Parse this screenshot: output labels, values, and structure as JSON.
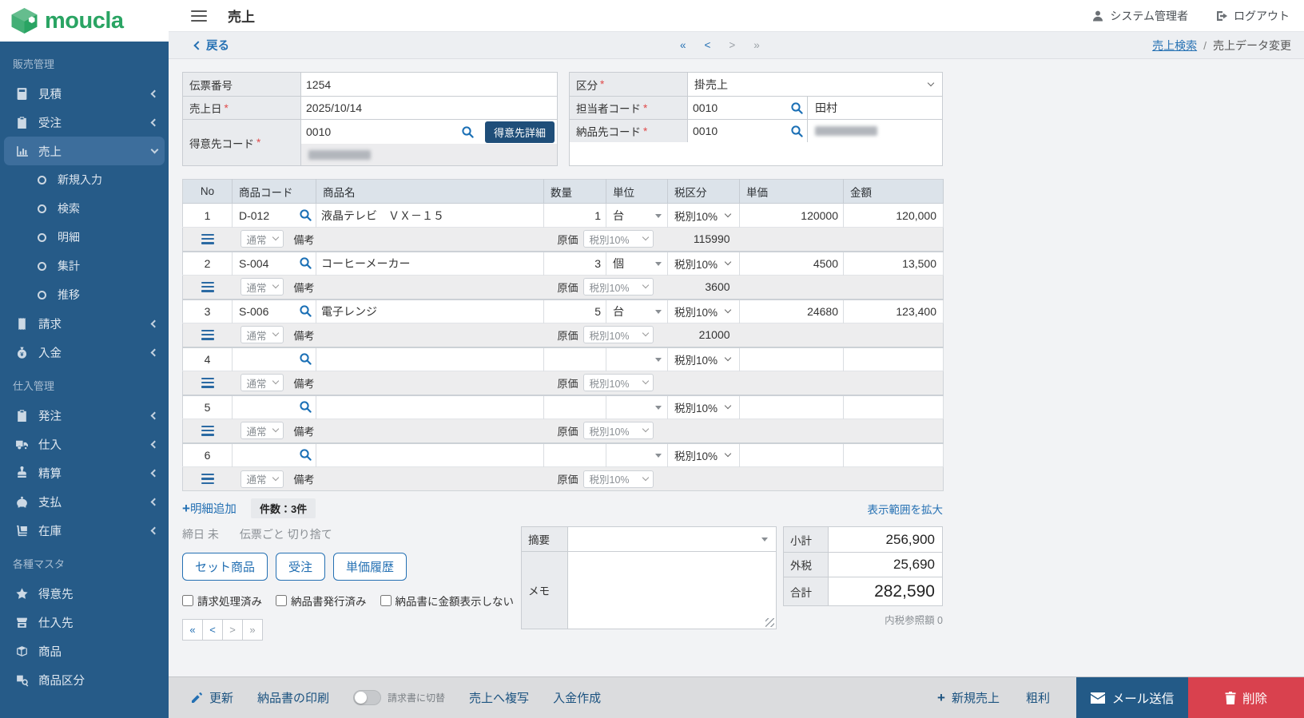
{
  "ui": {
    "required_mark": "*",
    "plus": "+"
  },
  "brand": {
    "name": "moucla"
  },
  "topbar": {
    "title": "売上",
    "user": "システム管理者",
    "logout": "ログアウト"
  },
  "navbar": {
    "back": "戻る",
    "pager": [
      "«",
      "<",
      ">",
      "»"
    ],
    "breadcrumb_link": "売上検索",
    "breadcrumb_sep": "/",
    "breadcrumb_current": "売上データ変更"
  },
  "sidebar": {
    "sections": [
      {
        "title": "販売管理",
        "items": [
          {
            "id": "estimate",
            "label": "見積",
            "icon": "estimate-icon",
            "state": "collapsed"
          },
          {
            "id": "order",
            "label": "受注",
            "icon": "order-icon",
            "state": "collapsed"
          },
          {
            "id": "sales",
            "label": "売上",
            "icon": "sales-icon",
            "state": "expanded",
            "active": true,
            "children": [
              {
                "id": "new-entry",
                "label": "新規入力"
              },
              {
                "id": "search",
                "label": "検索"
              },
              {
                "id": "detail",
                "label": "明細"
              },
              {
                "id": "summary",
                "label": "集計"
              },
              {
                "id": "trend",
                "label": "推移"
              }
            ]
          },
          {
            "id": "billing",
            "label": "請求",
            "icon": "billing-icon",
            "state": "collapsed"
          },
          {
            "id": "deposit",
            "label": "入金",
            "icon": "deposit-icon",
            "state": "collapsed"
          }
        ]
      },
      {
        "title": "仕入管理",
        "items": [
          {
            "id": "purchase-order",
            "label": "発注",
            "icon": "purchase-order-icon",
            "state": "collapsed"
          },
          {
            "id": "purchase",
            "label": "仕入",
            "icon": "purchase-icon",
            "state": "collapsed"
          },
          {
            "id": "settlement",
            "label": "精算",
            "icon": "settlement-icon",
            "state": "collapsed"
          },
          {
            "id": "payment",
            "label": "支払",
            "icon": "payment-icon",
            "state": "collapsed"
          },
          {
            "id": "inventory",
            "label": "在庫",
            "icon": "inventory-icon",
            "state": "collapsed"
          }
        ]
      },
      {
        "title": "各種マスタ",
        "items": [
          {
            "id": "customer",
            "label": "得意先",
            "icon": "customer-icon",
            "state": "none"
          },
          {
            "id": "supplier",
            "label": "仕入先",
            "icon": "supplier-icon",
            "state": "none"
          },
          {
            "id": "product",
            "label": "商品",
            "icon": "product-icon",
            "state": "none"
          },
          {
            "id": "product-category",
            "label": "商品区分",
            "icon": "product-category-icon",
            "state": "none"
          }
        ]
      }
    ]
  },
  "header_form": {
    "slip_no_label": "伝票番号",
    "slip_no": "1254",
    "sales_date_label": "売上日",
    "sales_date": "2025/10/14",
    "customer_code_label": "得意先コード",
    "customer_code": "0010",
    "customer_detail_button": "得意先詳細",
    "category_label": "区分",
    "category": "掛売上",
    "staff_code_label": "担当者コード",
    "staff_code": "0010",
    "staff_name": "田村",
    "delivery_code_label": "納品先コード",
    "delivery_code": "0010"
  },
  "detail_table": {
    "headers": [
      "No",
      "商品コード",
      "商品名",
      "数量",
      "単位",
      "税区分",
      "単価",
      "金額"
    ],
    "sub_labels": {
      "type_select": "通常",
      "note": "備考",
      "cost": "原価",
      "cost_tax": "税別10%"
    },
    "rows": [
      {
        "no": "1",
        "code": "D-012",
        "name": "液晶テレビ　ＶＸ－１５",
        "qty": "1",
        "unit": "台",
        "tax": "税別10%",
        "price": "120000",
        "amount": "120,000",
        "cost": "115990"
      },
      {
        "no": "2",
        "code": "S-004",
        "name": "コーヒーメーカー",
        "qty": "3",
        "unit": "個",
        "tax": "税別10%",
        "price": "4500",
        "amount": "13,500",
        "cost": "3600"
      },
      {
        "no": "3",
        "code": "S-006",
        "name": "電子レンジ",
        "qty": "5",
        "unit": "台",
        "tax": "税別10%",
        "price": "24680",
        "amount": "123,400",
        "cost": "21000"
      },
      {
        "no": "4",
        "code": "",
        "name": "",
        "qty": "",
        "unit": "",
        "tax": "税別10%",
        "price": "",
        "amount": "",
        "cost": ""
      },
      {
        "no": "5",
        "code": "",
        "name": "",
        "qty": "",
        "unit": "",
        "tax": "税別10%",
        "price": "",
        "amount": "",
        "cost": ""
      },
      {
        "no": "6",
        "code": "",
        "name": "",
        "qty": "",
        "unit": "",
        "tax": "税別10%",
        "price": "",
        "amount": "",
        "cost": ""
      }
    ]
  },
  "below_table": {
    "add_row": "明細追加",
    "count": "件数：3件",
    "expand": "表示範囲を拡大",
    "closing": "締日 未",
    "rounding": "伝票ごと 切り捨て",
    "buttons": [
      "セット商品",
      "受注",
      "単価履歴"
    ],
    "checkboxes": [
      "請求処理済み",
      "納品書発行済み",
      "納品書に金額表示しない"
    ],
    "pager": [
      "«",
      "<",
      ">",
      "»"
    ]
  },
  "summary_form": {
    "summary_label": "摘要",
    "memo_label": "メモ"
  },
  "totals": {
    "subtotal_label": "小計",
    "subtotal": "256,900",
    "tax_label": "外税",
    "tax": "25,690",
    "total_label": "合計",
    "total": "282,590",
    "inner_tax_note": "内税参照額 0"
  },
  "footer": {
    "update": "更新",
    "print": "納品書の印刷",
    "toggle_label": "請求書に切替",
    "copy": "売上へ複写",
    "create_deposit": "入金作成",
    "new_sales": "新規売上",
    "gross_profit": "粗利",
    "send_mail": "メール送信",
    "delete": "削除"
  },
  "colors": {
    "sidebar": "#265b88",
    "accent": "#1f4e79",
    "link": "#2470b3",
    "brand_green": "#2aa463",
    "danger": "#d9414e"
  }
}
